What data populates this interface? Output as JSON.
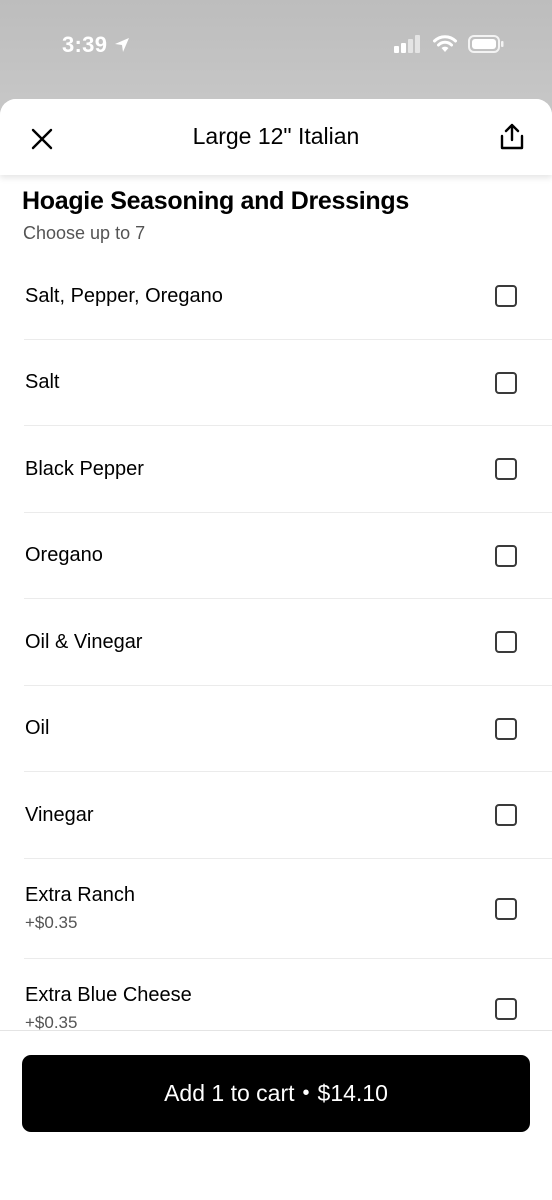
{
  "status_bar": {
    "time": "3:39",
    "icons": [
      "location-arrow-icon",
      "cellular-signal-icon",
      "wifi-icon",
      "battery-icon"
    ]
  },
  "header": {
    "title": "Large 12\" Italian",
    "close_icon": "close-icon",
    "share_icon": "share-icon"
  },
  "section": {
    "title": "Hoagie Seasoning and Dressings",
    "subtitle": "Choose up to 7"
  },
  "options": [
    {
      "label": "Salt, Pepper, Oregano",
      "price": "",
      "checked": false
    },
    {
      "label": "Salt",
      "price": "",
      "checked": false
    },
    {
      "label": "Black Pepper",
      "price": "",
      "checked": false
    },
    {
      "label": "Oregano",
      "price": "",
      "checked": false
    },
    {
      "label": "Oil & Vinegar",
      "price": "",
      "checked": false
    },
    {
      "label": "Oil",
      "price": "",
      "checked": false
    },
    {
      "label": "Vinegar",
      "price": "",
      "checked": false
    },
    {
      "label": "Extra Ranch",
      "price": "+$0.35",
      "checked": false
    },
    {
      "label": "Extra Blue Cheese",
      "price": "+$0.35",
      "checked": false
    }
  ],
  "footer": {
    "button_label": "Add 1 to cart",
    "separator": "•",
    "button_price": "$14.10"
  },
  "colors": {
    "button_bg": "#000000",
    "sheet_bg": "#ffffff",
    "secondary_text": "#545454"
  }
}
